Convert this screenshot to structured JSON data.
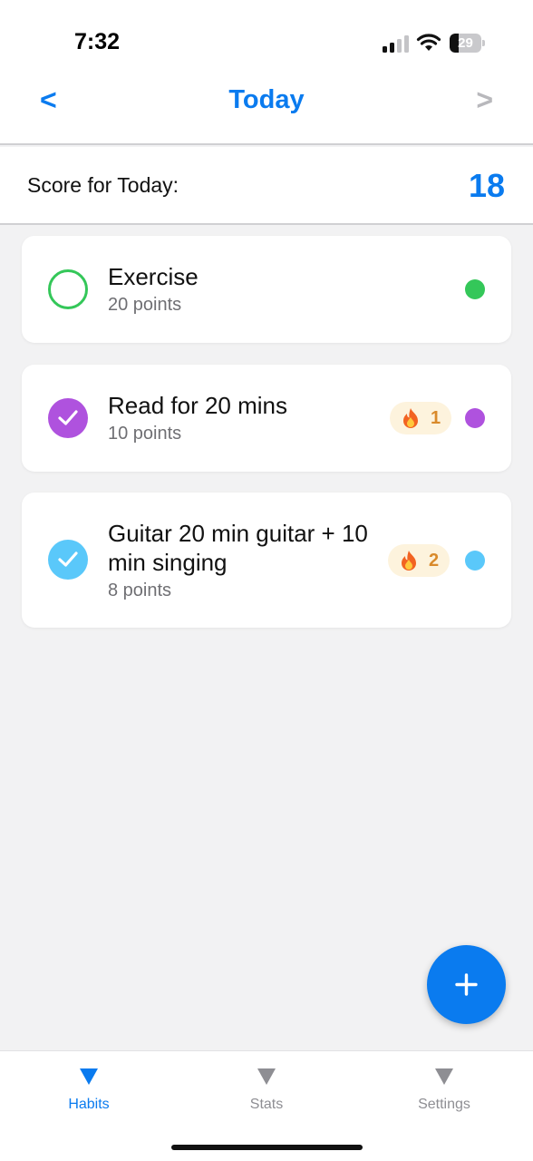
{
  "status_bar": {
    "time": "7:32",
    "battery_level": "29",
    "battery_fraction": 0.29,
    "icons": [
      "cellular-signal-icon",
      "wifi-icon",
      "battery-icon"
    ]
  },
  "header": {
    "prev_label": "<",
    "title": "Today",
    "next_label": ">"
  },
  "score": {
    "label": "Score for Today:",
    "value": "18"
  },
  "habits": [
    {
      "title": "Exercise",
      "points": "20 points",
      "completed": false,
      "color": "#34c759",
      "streak": null
    },
    {
      "title": "Read for 20 mins",
      "points": "10 points",
      "completed": true,
      "color": "#af52de",
      "streak": "1",
      "streak_icon": "fire-icon"
    },
    {
      "title": "Guitar 20 min guitar + 10 min singing",
      "points": "8 points",
      "completed": true,
      "color": "#5ac8fa",
      "streak": "2",
      "streak_icon": "fire-icon"
    }
  ],
  "fab": {
    "icon": "plus-icon"
  },
  "tabs": [
    {
      "label": "Habits",
      "active": true,
      "icon": "triangle-down-icon"
    },
    {
      "label": "Stats",
      "active": false,
      "icon": "triangle-down-icon"
    },
    {
      "label": "Settings",
      "active": false,
      "icon": "triangle-down-icon"
    }
  ],
  "colors": {
    "accent": "#0a7bef",
    "inactive_tab": "#8e8e93",
    "streak_text": "#d98a2b",
    "streak_bg": "#fdf3dd"
  }
}
